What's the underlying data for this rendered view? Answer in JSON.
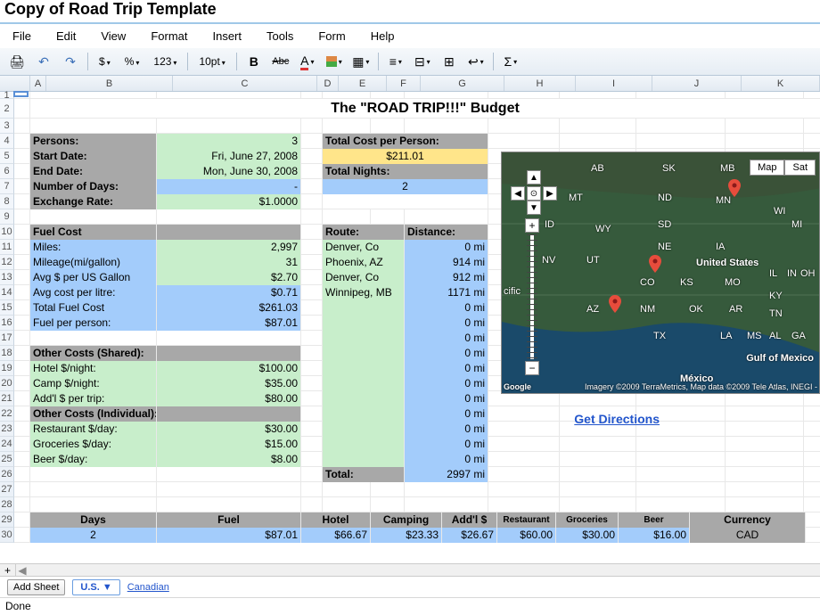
{
  "doc_title": "Copy of Road Trip Template",
  "menus": [
    "File",
    "Edit",
    "View",
    "Format",
    "Insert",
    "Tools",
    "Form",
    "Help"
  ],
  "toolbar": {
    "font_size": "10pt",
    "num_fmt": "123"
  },
  "columns": [
    {
      "letter": "A",
      "w": 18
    },
    {
      "letter": "B",
      "w": 142
    },
    {
      "letter": "C",
      "w": 162
    },
    {
      "letter": "D",
      "w": 24
    },
    {
      "letter": "E",
      "w": 54
    },
    {
      "letter": "F",
      "w": 38
    },
    {
      "letter": "G",
      "w": 94
    },
    {
      "letter": "H",
      "w": 80
    },
    {
      "letter": "I",
      "w": 86
    },
    {
      "letter": "J",
      "w": 100
    },
    {
      "letter": "K",
      "w": 88
    }
  ],
  "budget_title": "The \"ROAD TRIP!!!\" Budget",
  "info": {
    "persons_lbl": "Persons:",
    "persons": "3",
    "start_lbl": "Start Date:",
    "start": "Fri, June 27, 2008",
    "end_lbl": "End Date:",
    "end": "Mon, June 30, 2008",
    "numdays_lbl": "Number of Days:",
    "numdays": "-",
    "exchg_lbl": "Exchange Rate:",
    "exchg": "$1.0000",
    "tcpp_lbl": "Total Cost per Person:",
    "tcpp": "$211.01",
    "tn_lbl": "Total Nights:",
    "tn": "2"
  },
  "fuel": {
    "header": "Fuel Cost",
    "miles_lbl": "Miles:",
    "miles": "2,997",
    "mpg_lbl": "Mileage(mi/gallon)",
    "mpg": "31",
    "gallon_lbl": "Avg $ per US Gallon",
    "gallon": "$2.70",
    "litre_lbl": "Avg cost per litre:",
    "litre": "$0.71",
    "total_lbl": "Total Fuel Cost",
    "total": "$261.03",
    "per_lbl": "Fuel per person:",
    "per": "$87.01"
  },
  "other_shared": {
    "header": "Other Costs (Shared):",
    "hotel_lbl": "Hotel $/night:",
    "hotel": "$100.00",
    "camp_lbl": "Camp $/night:",
    "camp": "$35.00",
    "addl_lbl": "Add'l $ per trip:",
    "addl": "$80.00"
  },
  "other_ind": {
    "header": "Other Costs (Individual):",
    "rest_lbl": "Restaurant $/day:",
    "rest": "$30.00",
    "groc_lbl": "Groceries $/day:",
    "groc": "$15.00",
    "beer_lbl": "Beer $/day:",
    "beer": "$8.00"
  },
  "route": {
    "header_l": "Route:",
    "header_r": "Distance:",
    "rows": [
      {
        "city": "Denver, Co",
        "dist": "0 mi"
      },
      {
        "city": "Phoenix, AZ",
        "dist": "914 mi"
      },
      {
        "city": "Denver, Co",
        "dist": "912 mi"
      },
      {
        "city": "Winnipeg, MB",
        "dist": "1171 mi"
      },
      {
        "city": "",
        "dist": "0 mi"
      },
      {
        "city": "",
        "dist": "0 mi"
      },
      {
        "city": "",
        "dist": "0 mi"
      },
      {
        "city": "",
        "dist": "0 mi"
      },
      {
        "city": "",
        "dist": "0 mi"
      },
      {
        "city": "",
        "dist": "0 mi"
      },
      {
        "city": "",
        "dist": "0 mi"
      },
      {
        "city": "",
        "dist": "0 mi"
      },
      {
        "city": "",
        "dist": "0 mi"
      },
      {
        "city": "",
        "dist": "0 mi"
      },
      {
        "city": "",
        "dist": "0 mi"
      }
    ],
    "total_lbl": "Total:",
    "total": "2997 mi"
  },
  "summary": {
    "headers": [
      "Days",
      "Fuel",
      "Hotel",
      "Camping",
      "Add'l $",
      "Restaurant",
      "Groceries",
      "Beer",
      "Currency"
    ],
    "values": [
      "2",
      "$87.01",
      "$66.67",
      "$23.33",
      "$26.67",
      "$60.00",
      "$30.00",
      "$16.00",
      "CAD"
    ]
  },
  "map": {
    "tabs": [
      "Map",
      "Sat"
    ],
    "link": "Get Directions",
    "attr": "Imagery ©2009 TerraMetrics, Map data ©2009 Tele Atlas, INEGI -",
    "states": [
      "MT",
      "ID",
      "WY",
      "NV",
      "UT",
      "CO",
      "AZ",
      "NM",
      "TX",
      "OK",
      "KS",
      "NE",
      "SD",
      "ND",
      "MN",
      "IA",
      "MO",
      "AR",
      "LA",
      "MS",
      "AL",
      "GA",
      "TN",
      "KY",
      "IL",
      "IN",
      "OH",
      "WI",
      "MI",
      "AB",
      "SK",
      "MB"
    ],
    "labels": [
      "United States",
      "Gulf of Mexico",
      "México",
      "cific"
    ],
    "logo": "Google"
  },
  "sheets": {
    "add": "Add Sheet",
    "active": "U.S. ▼",
    "other": "Canadian"
  },
  "status": "Done"
}
